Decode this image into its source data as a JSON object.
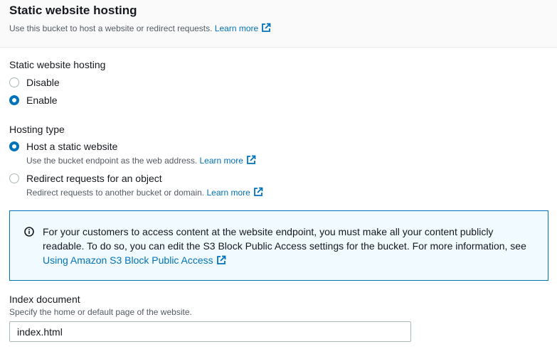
{
  "header": {
    "title": "Static website hosting",
    "description": "Use this bucket to host a website or redirect requests.",
    "learn_more": "Learn more"
  },
  "hosting": {
    "label": "Static website hosting",
    "options": [
      {
        "label": "Disable",
        "checked": false
      },
      {
        "label": "Enable",
        "checked": true
      }
    ]
  },
  "hosting_type": {
    "label": "Hosting type",
    "options": [
      {
        "label": "Host a static website",
        "description": "Use the bucket endpoint as the web address.",
        "learn_more": "Learn more",
        "checked": true
      },
      {
        "label": "Redirect requests for an object",
        "description": "Redirect requests to another bucket or domain.",
        "learn_more": "Learn more",
        "checked": false
      }
    ]
  },
  "alert": {
    "text": "For your customers to access content at the website endpoint, you must make all your content publicly readable. To do so, you can edit the S3 Block Public Access settings for the bucket. For more information, see",
    "link": "Using Amazon S3 Block Public Access"
  },
  "index_document": {
    "label": "Index document",
    "description": "Specify the home or default page of the website.",
    "value": "index.html"
  },
  "colors": {
    "accent": "#0073bb",
    "alert_bg": "#f1faff"
  }
}
